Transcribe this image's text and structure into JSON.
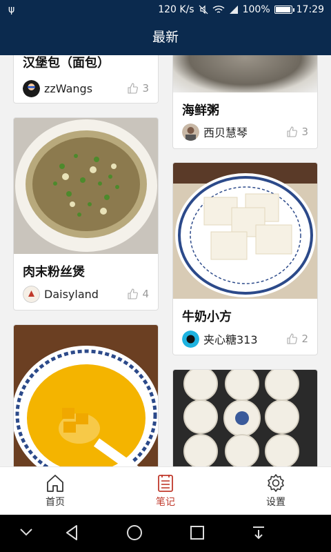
{
  "status_bar": {
    "usb_icon": "usb-icon",
    "network_speed": "120 K/s",
    "battery": "100%",
    "time": "17:29"
  },
  "header": {
    "title": "最新"
  },
  "feed": {
    "cards": [
      {
        "title": "汉堡包（面包）",
        "author": "zzWangs",
        "likes": "3"
      },
      {
        "title": "海鲜粥",
        "author": "西贝慧琴",
        "likes": "3"
      },
      {
        "title": "肉末粉丝煲",
        "author": "Daisyland",
        "likes": "4"
      },
      {
        "title": "牛奶小方",
        "author": "夹心糖313",
        "likes": "2"
      }
    ]
  },
  "tabbar": {
    "tabs": [
      {
        "label": "首页",
        "icon": "home-icon"
      },
      {
        "label": "笔记",
        "icon": "notes-icon"
      },
      {
        "label": "设置",
        "icon": "gear-icon"
      }
    ],
    "active_color": "#c0392b"
  },
  "theme": {
    "primary": "#0b2a4e"
  }
}
